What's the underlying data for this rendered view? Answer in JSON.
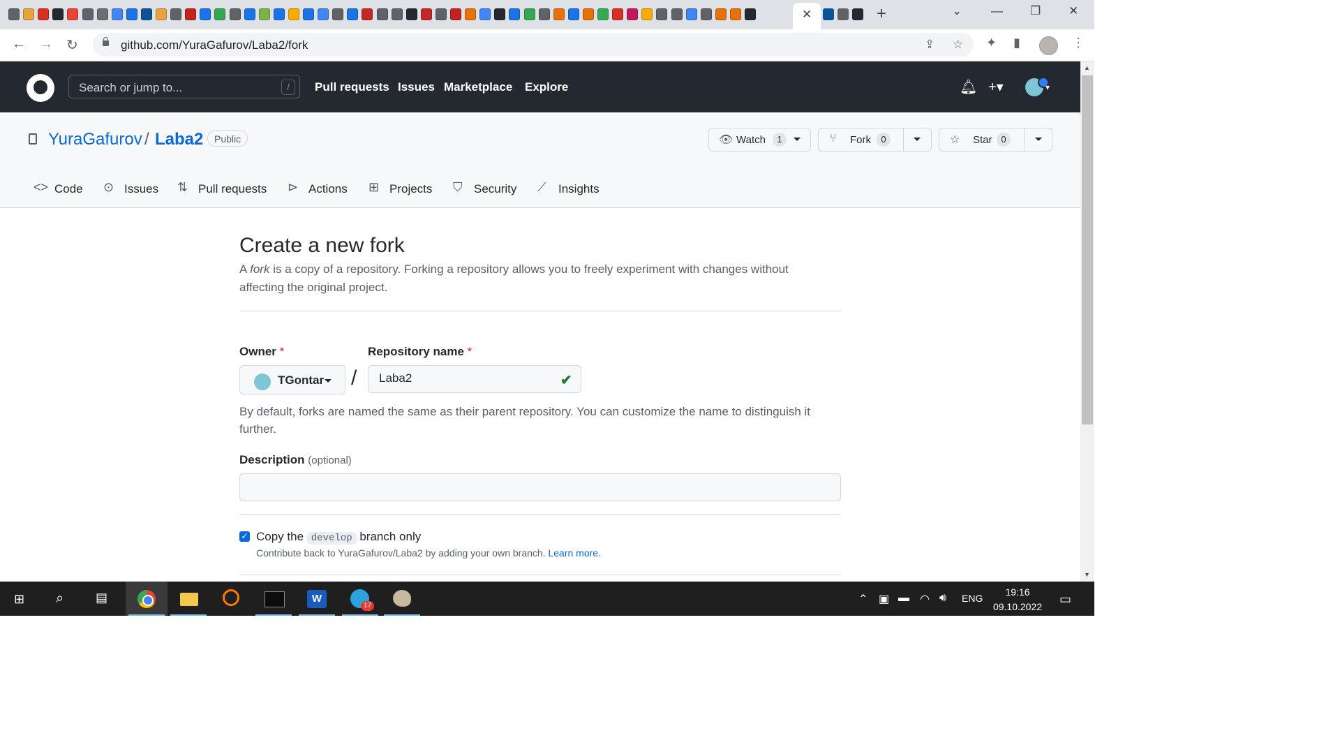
{
  "browser": {
    "url": "github.com/YuraGafurov/Laba2/fork",
    "tab_favicon_colors": [
      "#5f6368",
      "#e8a33d",
      "#d93025",
      "#24292f",
      "#ea4335",
      "#5f6368",
      "#6e6e6e",
      "#4285f4",
      "#1a73e8",
      "#0b5394",
      "#e8a33d",
      "#5f6368",
      "#c5221f",
      "#1a73e8",
      "#34a853",
      "#5f6368",
      "#1a73e8",
      "#7cb342",
      "#1a73e8",
      "#f9ab00",
      "#1a73e8",
      "#4285f4",
      "#5f6368",
      "#1a73e8",
      "#c62828",
      "#5f6368",
      "#5f6368",
      "#24292f",
      "#c62828",
      "#5f6368",
      "#c5221f",
      "#e8710a",
      "#4285f4",
      "#24292f",
      "#1a73e8",
      "#34a853",
      "#5f6368",
      "#e8710a",
      "#1a73e8",
      "#e8710a",
      "#34a853",
      "#d93025",
      "#c2185b",
      "#f9ab00",
      "#5f6368",
      "#5f6368",
      "#4285f4",
      "#5f6368",
      "#e8710a",
      "#e8710a",
      "#24292f"
    ],
    "tab_favicon_colors_after": [
      "#0b5394",
      "#5f6368",
      "#24292f"
    ],
    "new_tab_label": "+",
    "close_tab_label": "✕"
  },
  "github": {
    "search_placeholder": "Search or jump to...",
    "search_shortcut": "/",
    "nav": [
      "Pull requests",
      "Issues",
      "Marketplace",
      "Explore"
    ]
  },
  "repo": {
    "owner": "YuraGafurov",
    "separator": "/",
    "name": "Laba2",
    "visibility": "Public",
    "watch_label": "Watch",
    "watch_count": "1",
    "fork_label": "Fork",
    "fork_count": "0",
    "star_label": "Star",
    "star_count": "0",
    "tabs": [
      "Code",
      "Issues",
      "Pull requests",
      "Actions",
      "Projects",
      "Security",
      "Insights"
    ]
  },
  "form": {
    "title": "Create a new fork",
    "intro_prefix": "A ",
    "intro_em": "fork",
    "intro_suffix": " is a copy of a repository. Forking a repository allows you to freely experiment with changes without affecting the original project.",
    "owner_label": "Owner",
    "required_mark": "*",
    "owner_value": "TGontar",
    "slash": "/",
    "repo_name_label": "Repository name",
    "repo_name_value": "Laba2",
    "name_help": "By default, forks are named the same as their parent repository. You can customize the name to distinguish it further.",
    "description_label": "Description",
    "description_optional": "(optional)",
    "description_value": "",
    "copy_prefix": "Copy the",
    "copy_branch": "develop",
    "copy_suffix": "branch only",
    "copy_checked": true,
    "copy_sub": "Contribute back to YuraGafurov/Laba2 by adding your own branch.",
    "learn_more": "Learn more."
  },
  "taskbar": {
    "lang": "ENG",
    "time": "19:16",
    "date": "09.10.2022",
    "telegram_badge": "17"
  },
  "colors": {
    "accent": "#0969da",
    "header_bg": "#24292f",
    "success": "#1a7f37",
    "danger": "#cf222e"
  }
}
